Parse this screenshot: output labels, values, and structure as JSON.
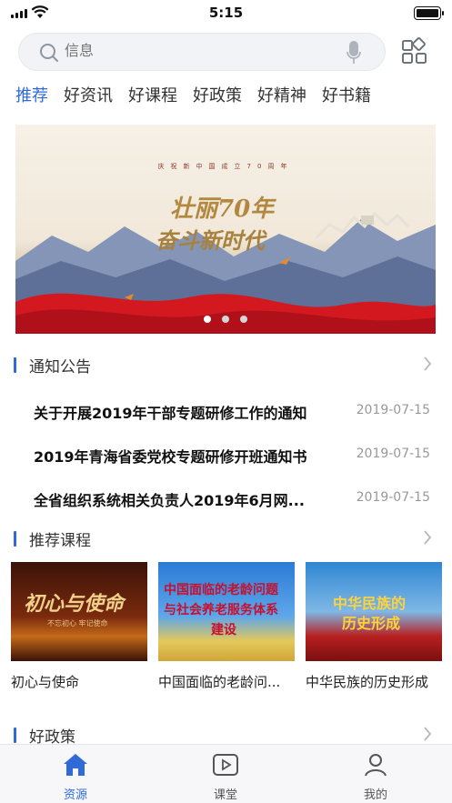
{
  "status_bar": {
    "time": "5:15"
  },
  "search": {
    "placeholder": "信息"
  },
  "tabs": [
    {
      "label": "推荐",
      "active": true
    },
    {
      "label": "好资讯",
      "active": false
    },
    {
      "label": "好课程",
      "active": false
    },
    {
      "label": "好政策",
      "active": false
    },
    {
      "label": "好精神",
      "active": false
    },
    {
      "label": "好书籍",
      "active": false
    }
  ],
  "banner": {
    "top_text": "庆祝新中国成立70周年",
    "title_line1": "壮丽70年",
    "title_line2": "奋斗新时代",
    "slides": 3,
    "active_slide": 1
  },
  "notices": {
    "title": "通知公告",
    "items": [
      {
        "title": "关于开展2019年干部专题研修工作的通知",
        "date": "2019-07-15"
      },
      {
        "title": "2019年青海省委党校专题研修开班通知书",
        "date": "2019-07-15"
      },
      {
        "title": "全省组织系统相关负责人2019年6月网...",
        "date": "2019-07-15"
      }
    ]
  },
  "courses": {
    "title": "推荐课程",
    "items": [
      {
        "title": "初心与使命",
        "thumb_text": "初心与使命",
        "thumb_sub": "不忘初心 牢记使命"
      },
      {
        "title": "中国面临的老龄问...",
        "thumb_text": "中国面临的老龄问题",
        "thumb_text2": "与社会养老服务体系",
        "thumb_text3": "建设"
      },
      {
        "title": "中华民族的历史形成",
        "thumb_text": "中华民族的",
        "thumb_text2": "历史形成"
      }
    ]
  },
  "policy": {
    "title": "好政策"
  },
  "bottom_nav": [
    {
      "label": "资源",
      "icon": "home-icon",
      "active": true
    },
    {
      "label": "课堂",
      "icon": "play-icon",
      "active": false
    },
    {
      "label": "我的",
      "icon": "profile-icon",
      "active": false
    }
  ],
  "colors": {
    "accent": "#2f6ad8",
    "date_gray": "#999999",
    "search_bg": "#f1f3f6"
  }
}
